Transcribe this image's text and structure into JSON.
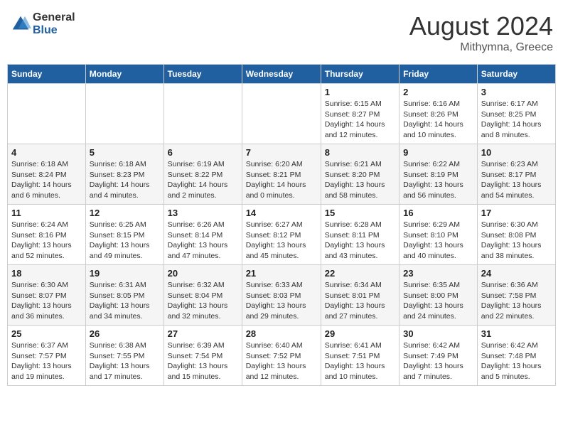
{
  "header": {
    "logo_general": "General",
    "logo_blue": "Blue",
    "month_year": "August 2024",
    "location": "Mithymna, Greece"
  },
  "days_of_week": [
    "Sunday",
    "Monday",
    "Tuesday",
    "Wednesday",
    "Thursday",
    "Friday",
    "Saturday"
  ],
  "weeks": [
    [
      {
        "day": "",
        "content": ""
      },
      {
        "day": "",
        "content": ""
      },
      {
        "day": "",
        "content": ""
      },
      {
        "day": "",
        "content": ""
      },
      {
        "day": "1",
        "content": "Sunrise: 6:15 AM\nSunset: 8:27 PM\nDaylight: 14 hours\nand 12 minutes."
      },
      {
        "day": "2",
        "content": "Sunrise: 6:16 AM\nSunset: 8:26 PM\nDaylight: 14 hours\nand 10 minutes."
      },
      {
        "day": "3",
        "content": "Sunrise: 6:17 AM\nSunset: 8:25 PM\nDaylight: 14 hours\nand 8 minutes."
      }
    ],
    [
      {
        "day": "4",
        "content": "Sunrise: 6:18 AM\nSunset: 8:24 PM\nDaylight: 14 hours\nand 6 minutes."
      },
      {
        "day": "5",
        "content": "Sunrise: 6:18 AM\nSunset: 8:23 PM\nDaylight: 14 hours\nand 4 minutes."
      },
      {
        "day": "6",
        "content": "Sunrise: 6:19 AM\nSunset: 8:22 PM\nDaylight: 14 hours\nand 2 minutes."
      },
      {
        "day": "7",
        "content": "Sunrise: 6:20 AM\nSunset: 8:21 PM\nDaylight: 14 hours\nand 0 minutes."
      },
      {
        "day": "8",
        "content": "Sunrise: 6:21 AM\nSunset: 8:20 PM\nDaylight: 13 hours\nand 58 minutes."
      },
      {
        "day": "9",
        "content": "Sunrise: 6:22 AM\nSunset: 8:19 PM\nDaylight: 13 hours\nand 56 minutes."
      },
      {
        "day": "10",
        "content": "Sunrise: 6:23 AM\nSunset: 8:17 PM\nDaylight: 13 hours\nand 54 minutes."
      }
    ],
    [
      {
        "day": "11",
        "content": "Sunrise: 6:24 AM\nSunset: 8:16 PM\nDaylight: 13 hours\nand 52 minutes."
      },
      {
        "day": "12",
        "content": "Sunrise: 6:25 AM\nSunset: 8:15 PM\nDaylight: 13 hours\nand 49 minutes."
      },
      {
        "day": "13",
        "content": "Sunrise: 6:26 AM\nSunset: 8:14 PM\nDaylight: 13 hours\nand 47 minutes."
      },
      {
        "day": "14",
        "content": "Sunrise: 6:27 AM\nSunset: 8:12 PM\nDaylight: 13 hours\nand 45 minutes."
      },
      {
        "day": "15",
        "content": "Sunrise: 6:28 AM\nSunset: 8:11 PM\nDaylight: 13 hours\nand 43 minutes."
      },
      {
        "day": "16",
        "content": "Sunrise: 6:29 AM\nSunset: 8:10 PM\nDaylight: 13 hours\nand 40 minutes."
      },
      {
        "day": "17",
        "content": "Sunrise: 6:30 AM\nSunset: 8:08 PM\nDaylight: 13 hours\nand 38 minutes."
      }
    ],
    [
      {
        "day": "18",
        "content": "Sunrise: 6:30 AM\nSunset: 8:07 PM\nDaylight: 13 hours\nand 36 minutes."
      },
      {
        "day": "19",
        "content": "Sunrise: 6:31 AM\nSunset: 8:05 PM\nDaylight: 13 hours\nand 34 minutes."
      },
      {
        "day": "20",
        "content": "Sunrise: 6:32 AM\nSunset: 8:04 PM\nDaylight: 13 hours\nand 32 minutes."
      },
      {
        "day": "21",
        "content": "Sunrise: 6:33 AM\nSunset: 8:03 PM\nDaylight: 13 hours\nand 29 minutes."
      },
      {
        "day": "22",
        "content": "Sunrise: 6:34 AM\nSunset: 8:01 PM\nDaylight: 13 hours\nand 27 minutes."
      },
      {
        "day": "23",
        "content": "Sunrise: 6:35 AM\nSunset: 8:00 PM\nDaylight: 13 hours\nand 24 minutes."
      },
      {
        "day": "24",
        "content": "Sunrise: 6:36 AM\nSunset: 7:58 PM\nDaylight: 13 hours\nand 22 minutes."
      }
    ],
    [
      {
        "day": "25",
        "content": "Sunrise: 6:37 AM\nSunset: 7:57 PM\nDaylight: 13 hours\nand 19 minutes."
      },
      {
        "day": "26",
        "content": "Sunrise: 6:38 AM\nSunset: 7:55 PM\nDaylight: 13 hours\nand 17 minutes."
      },
      {
        "day": "27",
        "content": "Sunrise: 6:39 AM\nSunset: 7:54 PM\nDaylight: 13 hours\nand 15 minutes."
      },
      {
        "day": "28",
        "content": "Sunrise: 6:40 AM\nSunset: 7:52 PM\nDaylight: 13 hours\nand 12 minutes."
      },
      {
        "day": "29",
        "content": "Sunrise: 6:41 AM\nSunset: 7:51 PM\nDaylight: 13 hours\nand 10 minutes."
      },
      {
        "day": "30",
        "content": "Sunrise: 6:42 AM\nSunset: 7:49 PM\nDaylight: 13 hours\nand 7 minutes."
      },
      {
        "day": "31",
        "content": "Sunrise: 6:42 AM\nSunset: 7:48 PM\nDaylight: 13 hours\nand 5 minutes."
      }
    ]
  ]
}
